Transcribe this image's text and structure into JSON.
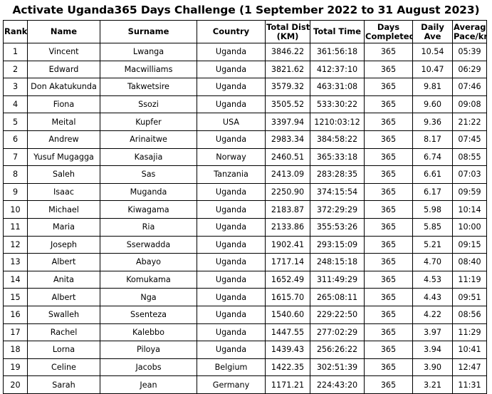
{
  "title": "Activate Uganda365 Days Challenge (1 September 2022 to 31 August 2023)",
  "colors": {
    "highlight_yellow": "#FFFF00",
    "highlight_green": "#00D820",
    "grid_line": "#000000",
    "background": "#FFFFFF",
    "text": "#000000"
  },
  "table": {
    "columns": [
      {
        "key": "rank",
        "label": "Rank",
        "header_fill": "none"
      },
      {
        "key": "name",
        "label": "Name",
        "header_fill": "none"
      },
      {
        "key": "surname",
        "label": "Surname",
        "header_fill": "none"
      },
      {
        "key": "country",
        "label": "Country",
        "header_fill": "none"
      },
      {
        "key": "dist",
        "label": "Total Dist (KM)",
        "header_fill": "yellow"
      },
      {
        "key": "time",
        "label": "Total Time",
        "header_fill": "yellow"
      },
      {
        "key": "days",
        "label": "Days Completed",
        "header_fill": "yellow"
      },
      {
        "key": "ave",
        "label": "Daily Ave",
        "header_fill": "green"
      },
      {
        "key": "pace",
        "label": "Average Pace/km",
        "header_fill": "yellow"
      }
    ],
    "header_lines": {
      "rank": [
        "Rank"
      ],
      "name": [
        "Name"
      ],
      "surname": [
        "Surname"
      ],
      "country": [
        "Country"
      ],
      "dist": [
        "Total Dist",
        "(KM)"
      ],
      "time": [
        "Total Time"
      ],
      "days": [
        "Days",
        "Completed"
      ],
      "ave": [
        "Daily",
        "Ave"
      ],
      "pace": [
        "Average",
        "Pace/km"
      ]
    },
    "rows": [
      {
        "rank": "1",
        "name": "Vincent",
        "surname": "Lwanga",
        "country": "Uganda",
        "dist": "3846.22",
        "time": "361:56:18",
        "days": "365",
        "ave": "10.54",
        "pace": "05:39"
      },
      {
        "rank": "2",
        "name": "Edward",
        "surname": "Macwilliams",
        "country": "Uganda",
        "dist": "3821.62",
        "time": "412:37:10",
        "days": "365",
        "ave": "10.47",
        "pace": "06:29"
      },
      {
        "rank": "3",
        "name": "Don Akatukunda",
        "surname": "Takwetsire",
        "country": "Uganda",
        "dist": "3579.32",
        "time": "463:31:08",
        "days": "365",
        "ave": "9.81",
        "pace": "07:46"
      },
      {
        "rank": "4",
        "name": "Fiona",
        "surname": "Ssozi",
        "country": "Uganda",
        "dist": "3505.52",
        "time": "533:30:22",
        "days": "365",
        "ave": "9.60",
        "pace": "09:08"
      },
      {
        "rank": "5",
        "name": "Meital",
        "surname": "Kupfer",
        "country": "USA",
        "dist": "3397.94",
        "time": "1210:03:12",
        "days": "365",
        "ave": "9.36",
        "pace": "21:22"
      },
      {
        "rank": "6",
        "name": "Andrew",
        "surname": "Arinaitwe",
        "country": "Uganda",
        "dist": "2983.34",
        "time": "384:58:22",
        "days": "365",
        "ave": "8.17",
        "pace": "07:45"
      },
      {
        "rank": "7",
        "name": "Yusuf Mugagga",
        "surname": "Kasajia",
        "country": "Norway",
        "dist": "2460.51",
        "time": "365:33:18",
        "days": "365",
        "ave": "6.74",
        "pace": "08:55"
      },
      {
        "rank": "8",
        "name": "Saleh",
        "surname": "Sas",
        "country": "Tanzania",
        "dist": "2413.09",
        "time": "283:28:35",
        "days": "365",
        "ave": "6.61",
        "pace": "07:03"
      },
      {
        "rank": "9",
        "name": "Isaac",
        "surname": "Muganda",
        "country": "Uganda",
        "dist": "2250.90",
        "time": "374:15:54",
        "days": "365",
        "ave": "6.17",
        "pace": "09:59"
      },
      {
        "rank": "10",
        "name": "Michael",
        "surname": "Kiwagama",
        "country": "Uganda",
        "dist": "2183.87",
        "time": "372:29:29",
        "days": "365",
        "ave": "5.98",
        "pace": "10:14"
      },
      {
        "rank": "11",
        "name": "Maria",
        "surname": "Ria",
        "country": "Uganda",
        "dist": "2133.86",
        "time": "355:53:26",
        "days": "365",
        "ave": "5.85",
        "pace": "10:00"
      },
      {
        "rank": "12",
        "name": "Joseph",
        "surname": "Sserwadda",
        "country": "Uganda",
        "dist": "1902.41",
        "time": "293:15:09",
        "days": "365",
        "ave": "5.21",
        "pace": "09:15"
      },
      {
        "rank": "13",
        "name": "Albert",
        "surname": "Abayo",
        "country": "Uganda",
        "dist": "1717.14",
        "time": "248:15:18",
        "days": "365",
        "ave": "4.70",
        "pace": "08:40"
      },
      {
        "rank": "14",
        "name": "Anita",
        "surname": "Komukama",
        "country": "Uganda",
        "dist": "1652.49",
        "time": "311:49:29",
        "days": "365",
        "ave": "4.53",
        "pace": "11:19"
      },
      {
        "rank": "15",
        "name": "Albert",
        "surname": "Nga",
        "country": "Uganda",
        "dist": "1615.70",
        "time": "265:08:11",
        "days": "365",
        "ave": "4.43",
        "pace": "09:51"
      },
      {
        "rank": "16",
        "name": "Swalleh",
        "surname": "Ssenteza",
        "country": "Uganda",
        "dist": "1540.60",
        "time": "229:22:50",
        "days": "365",
        "ave": "4.22",
        "pace": "08:56"
      },
      {
        "rank": "17",
        "name": "Rachel",
        "surname": "Kalebbo",
        "country": "Uganda",
        "dist": "1447.55",
        "time": "277:02:29",
        "days": "365",
        "ave": "3.97",
        "pace": "11:29"
      },
      {
        "rank": "18",
        "name": "Lorna",
        "surname": "Piloya",
        "country": "Uganda",
        "dist": "1439.43",
        "time": "256:26:22",
        "days": "365",
        "ave": "3.94",
        "pace": "10:41"
      },
      {
        "rank": "19",
        "name": "Celine",
        "surname": "Jacobs",
        "country": "Belgium",
        "dist": "1422.35",
        "time": "302:51:39",
        "days": "365",
        "ave": "3.90",
        "pace": "12:47"
      },
      {
        "rank": "20",
        "name": "Sarah",
        "surname": "Jean",
        "country": "Germany",
        "dist": "1171.21",
        "time": "224:43:20",
        "days": "365",
        "ave": "3.21",
        "pace": "11:31"
      }
    ]
  }
}
